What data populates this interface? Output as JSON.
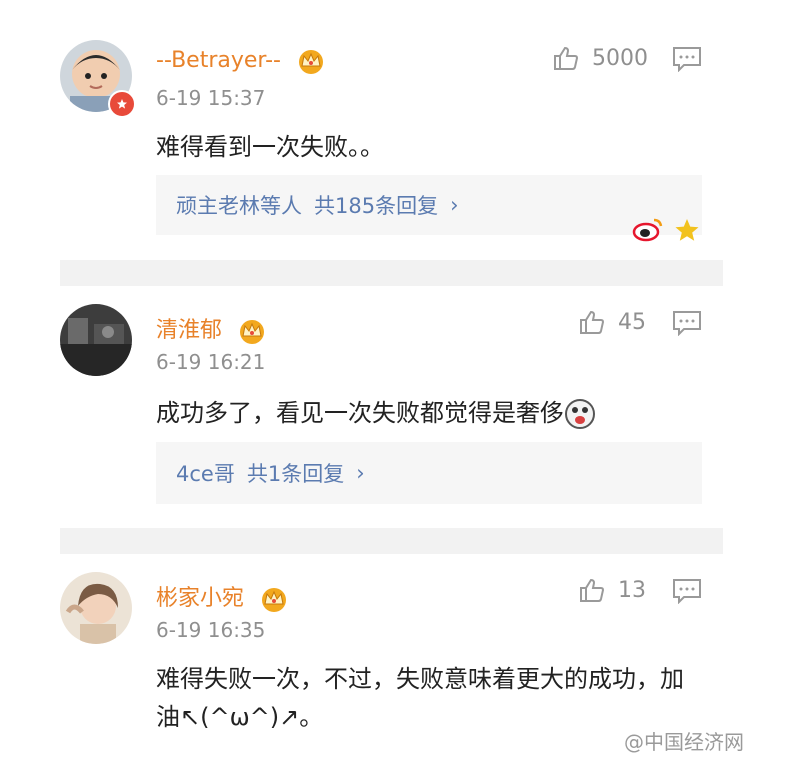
{
  "comments": [
    {
      "username": "--Betrayer--",
      "time": "6-19 15:37",
      "likes": "5000",
      "content": "难得看到一次失败。。",
      "reply_users": "顽主老林等人",
      "reply_count": "共185条回复",
      "avatar_badge_color": "#e84a3a"
    },
    {
      "username": "清淮郁",
      "time": "6-19 16:21",
      "likes": "45",
      "content": "成功多了，看见一次失败都觉得是奢侈",
      "reply_users": "4ce哥",
      "reply_count": "共1条回复"
    },
    {
      "username": "彬家小宛",
      "time": "6-19 16:35",
      "likes": "13",
      "content": "难得失败一次，不过，失败意味着更大的成功，加油↖(^ω^)↗。"
    }
  ],
  "colors": {
    "username": "#e8822a",
    "reply_link": "#5b7bb0",
    "meta": "#8f8f8f",
    "crown": "#f2a81e"
  },
  "watermark": {
    "text": "@中国经济网"
  },
  "icons": {
    "like": "thumbs-up-icon",
    "reply": "comment-icon",
    "vip": "crown-icon",
    "weibo": "weibo-logo-icon",
    "star": "star-icon"
  }
}
